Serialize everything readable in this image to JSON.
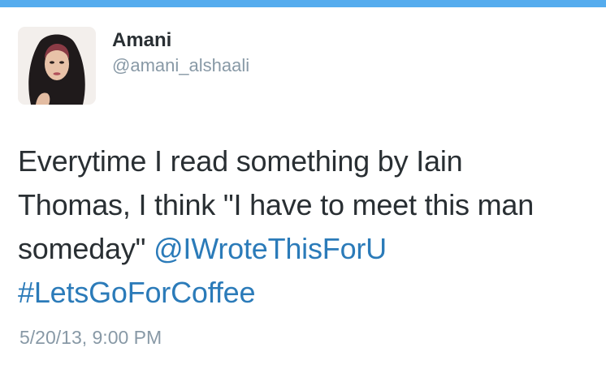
{
  "colors": {
    "top_bar": "#55acee",
    "text": "#292f33",
    "muted": "#8899a6",
    "link": "#2b7bb9"
  },
  "author": {
    "avatar_icon": "user-profile-photo",
    "display_name": "Amani",
    "screen_name": "@amani_alshaali"
  },
  "tweet": {
    "line1": "Everytime I read something by Iain",
    "line2": "Thomas, I think \"I have to meet this man",
    "line3_text": "someday\" ",
    "mention": "@IWroteThisForU",
    "hashtag": "#LetsGoForCoffee",
    "timestamp": "5/20/13, 9:00 PM"
  }
}
